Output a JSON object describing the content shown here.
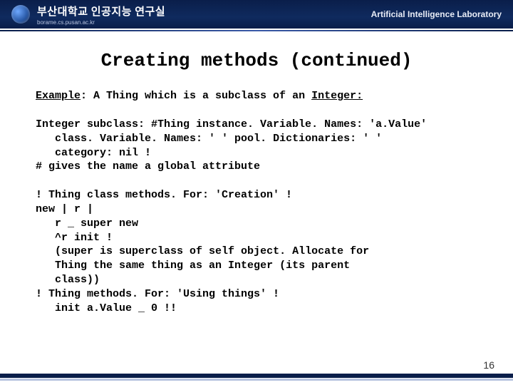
{
  "header": {
    "title_korean": "부산대학교 인공지능 연구실",
    "subtitle": "borame.cs.pusan.ac.kr",
    "right": "Artificial Intelligence Laboratory"
  },
  "title": "Creating methods (continued)",
  "example_prefix": "Example",
  "example_mid": ": A Thing which is a subclass of an ",
  "example_suffix": "Integer:",
  "code1": "Integer subclass: #Thing instance. Variable. Names: 'a.Value'\n   class. Variable. Names: ' ' pool. Dictionaries: ' '\n   category: nil !\n# gives the name a global attribute",
  "code2": "! Thing class methods. For: 'Creation' !\nnew | r |\n   r _ super new\n   ^r init !\n   (super is superclass of self object. Allocate for\n   Thing the same thing as an Integer (its parent\n   class))\n! Thing methods. For: 'Using things' !\n   init a.Value _ 0 !!",
  "page_number": "16"
}
